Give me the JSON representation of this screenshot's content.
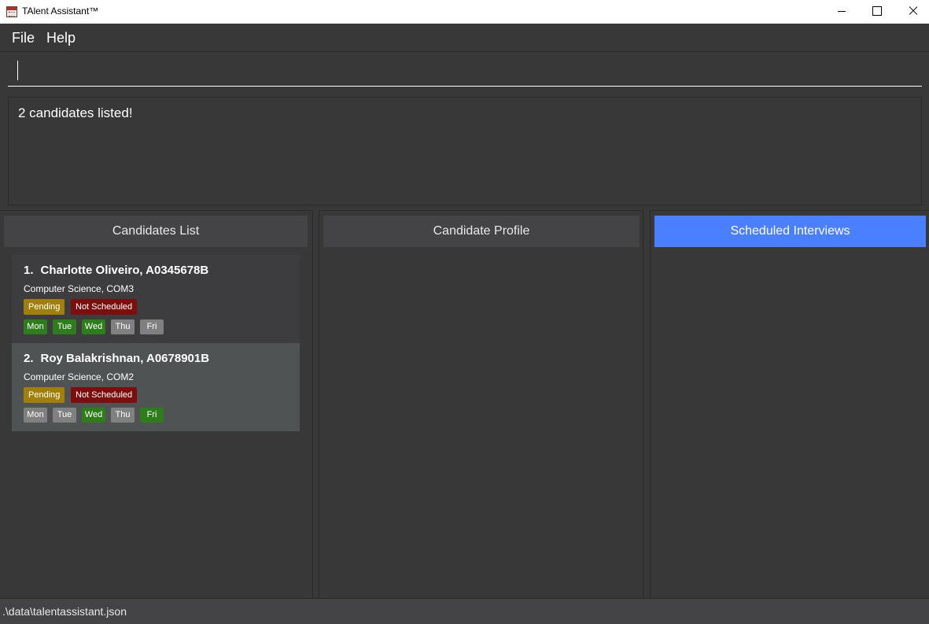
{
  "window": {
    "title": "TAlent Assistant™"
  },
  "menu": {
    "items": [
      {
        "label": "File"
      },
      {
        "label": "Help"
      }
    ]
  },
  "command": {
    "value": "",
    "placeholder": ""
  },
  "result": {
    "message": "2 candidates listed!"
  },
  "panels": {
    "candidates_header": "Candidates List",
    "profile_header": "Candidate Profile",
    "interviews_header": "Scheduled Interviews"
  },
  "colors": {
    "accent": "#4a7fff",
    "pending": "#a07f0c",
    "not_scheduled": "#7c0e0e",
    "available": "#2d7d1b",
    "unavailable": "#808080"
  },
  "candidates": [
    {
      "index": "1.",
      "name": "Charlotte Oliveiro, A0345678B",
      "course": "Computer Science, COM3",
      "status": "Pending",
      "interview": "Not Scheduled",
      "days": [
        {
          "label": "Mon",
          "available": true
        },
        {
          "label": "Tue",
          "available": true
        },
        {
          "label": "Wed",
          "available": true
        },
        {
          "label": "Thu",
          "available": false
        },
        {
          "label": "Fri",
          "available": false
        }
      ]
    },
    {
      "index": "2.",
      "name": "Roy Balakrishnan, A0678901B",
      "course": "Computer Science, COM2",
      "status": "Pending",
      "interview": "Not Scheduled",
      "days": [
        {
          "label": "Mon",
          "available": false
        },
        {
          "label": "Tue",
          "available": false
        },
        {
          "label": "Wed",
          "available": true
        },
        {
          "label": "Thu",
          "available": false
        },
        {
          "label": "Fri",
          "available": true
        }
      ]
    }
  ],
  "status_bar": {
    "path": ".\\data\\talentassistant.json"
  }
}
